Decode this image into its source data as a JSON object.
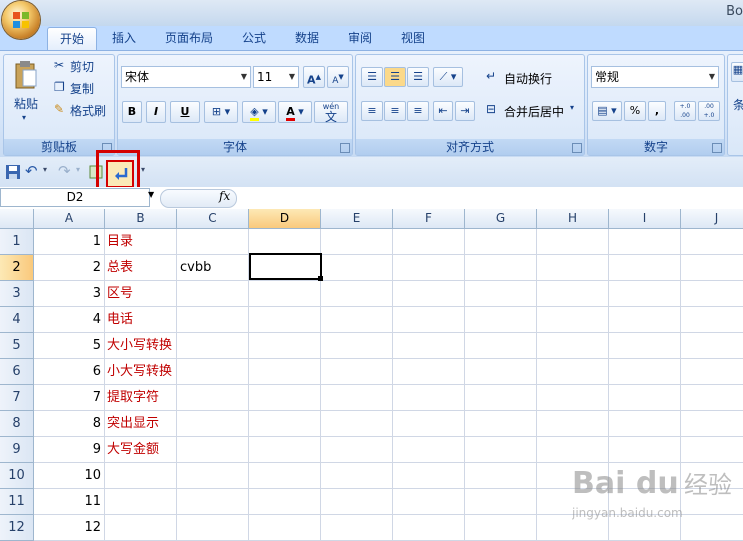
{
  "window": {
    "title": "Bo"
  },
  "tabs": [
    "开始",
    "插入",
    "页面布局",
    "公式",
    "数据",
    "审阅",
    "视图"
  ],
  "ribbon": {
    "clipboard": {
      "label": "剪贴板",
      "paste": "粘贴",
      "cut": "剪切",
      "copy": "复制",
      "format_painter": "格式刷"
    },
    "font": {
      "label": "字体",
      "font_name": "宋体",
      "font_size": "11",
      "bold": "B",
      "italic": "I",
      "underline": "U",
      "grow": "A",
      "shrink": "A",
      "font_color_letter": "A",
      "phonetic": "wén"
    },
    "alignment": {
      "label": "对齐方式",
      "wrap_text": "自动换行",
      "merge_center": "合并后居中"
    },
    "number": {
      "label": "数字",
      "format": "常规",
      "percent": "%",
      "comma": ",",
      "inc_decimal": "+.0 .00",
      "dec_decimal": ".00 +.0"
    },
    "styles": {
      "label": "条"
    }
  },
  "formula_bar": {
    "name_box": "D2",
    "fx": "fx",
    "formula": ""
  },
  "columns": [
    "A",
    "B",
    "C",
    "D",
    "E",
    "F",
    "G",
    "H",
    "I",
    "J"
  ],
  "selected_column": "D",
  "rows": [
    {
      "num": "1",
      "a": "1",
      "b": "目录",
      "c": ""
    },
    {
      "num": "2",
      "a": "2",
      "b": "总表",
      "c": "cvbb"
    },
    {
      "num": "3",
      "a": "3",
      "b": "区号",
      "c": ""
    },
    {
      "num": "4",
      "a": "4",
      "b": "电话",
      "c": ""
    },
    {
      "num": "5",
      "a": "5",
      "b": "大小写转换",
      "c": ""
    },
    {
      "num": "6",
      "a": "6",
      "b": "小大写转换",
      "c": ""
    },
    {
      "num": "7",
      "a": "7",
      "b": "提取字符",
      "c": ""
    },
    {
      "num": "8",
      "a": "8",
      "b": "突出显示",
      "c": ""
    },
    {
      "num": "9",
      "a": "9",
      "b": "大写金额",
      "c": ""
    },
    {
      "num": "10",
      "a": "10",
      "b": "",
      "c": ""
    },
    {
      "num": "11",
      "a": "11",
      "b": "",
      "c": ""
    },
    {
      "num": "12",
      "a": "12",
      "b": "",
      "c": ""
    }
  ],
  "selected_row": "2",
  "watermark": {
    "brand": "Bai du",
    "text": "经验",
    "url": "jingyan.baidu.com"
  },
  "colors": {
    "accent": "#15428b",
    "highlight": "#d40000",
    "red_text": "#c00000"
  }
}
